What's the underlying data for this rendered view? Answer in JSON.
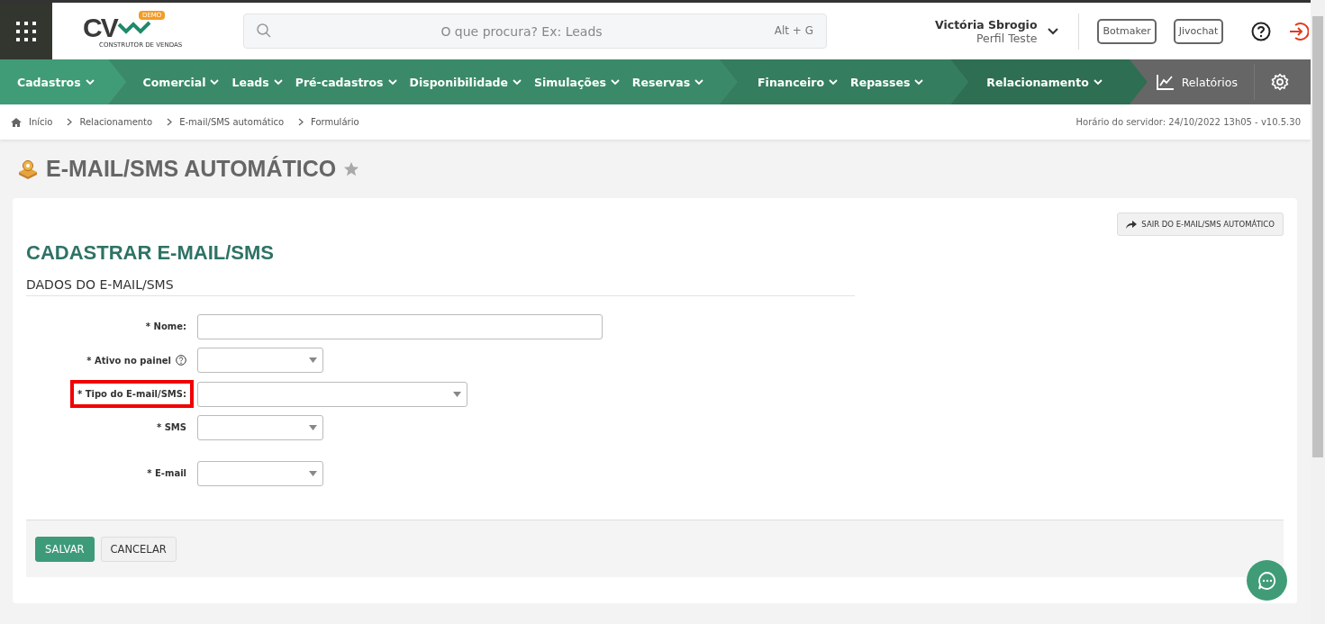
{
  "header": {
    "logo": {
      "letters": "CV",
      "badge": "DEMO",
      "tagline": "CONSTRUTOR DE VENDAS"
    },
    "search": {
      "placeholder": "O que procura? Ex: Leads",
      "shortcut": "Alt + G"
    },
    "user": {
      "name": "Victória Sbrogio",
      "profile": "Perfil Teste"
    },
    "buttons": [
      "Botmaker",
      "Jivochat"
    ]
  },
  "nav": {
    "groups": [
      {
        "color": "#3f9c77",
        "items": [
          "Cadastros"
        ]
      },
      {
        "color": "#3a8a69",
        "items": [
          "Comercial",
          "Leads",
          "Pré-cadastros",
          "Disponibilidade",
          "Simulações",
          "Reservas"
        ]
      },
      {
        "color": "#357d5f",
        "items": [
          "Financeiro",
          "Repasses"
        ]
      },
      {
        "color": "#2e6e52",
        "items": [
          "Relacionamento"
        ]
      }
    ],
    "reports": "Relatórios"
  },
  "breadcrumb": [
    "Início",
    "Relacionamento",
    "E-mail/SMS automático",
    "Formulário"
  ],
  "server_time": "Horário do servidor: 24/10/2022 13h05 - v10.5.30",
  "page_title": "E-MAIL/SMS AUTOMÁTICO",
  "exit_button": "SAIR DO E-MAIL/SMS AUTOMÁTICO",
  "form": {
    "title": "CADASTRAR E-MAIL/SMS",
    "section": "DADOS DO E-MAIL/SMS",
    "fields": [
      {
        "label": "* Nome:",
        "kind": "text",
        "help": false,
        "highlighted": false
      },
      {
        "label": "* Ativo no painel",
        "kind": "short-select",
        "help": true,
        "highlighted": false
      },
      {
        "label": "* Tipo do E-mail/SMS:",
        "kind": "long-select",
        "help": false,
        "highlighted": true
      },
      {
        "label": "* SMS",
        "kind": "short-select",
        "help": false,
        "highlighted": false
      },
      {
        "label": "* E-mail",
        "kind": "short-select",
        "help": false,
        "highlighted": false
      }
    ],
    "buttons": [
      {
        "label": "SALVAR",
        "kind": "primary"
      },
      {
        "label": "CANCELAR",
        "kind": "secondary"
      }
    ]
  }
}
